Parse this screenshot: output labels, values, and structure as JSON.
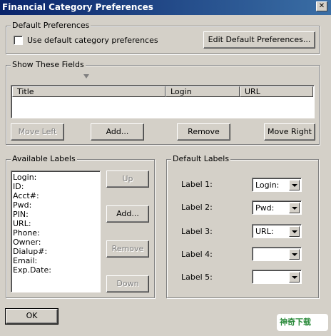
{
  "window": {
    "title": "Financial Category Preferences",
    "close_glyph": "✕"
  },
  "default_preferences": {
    "label": "Default Preferences",
    "checkbox_label": "Use default category preferences",
    "checkbox_checked": false,
    "edit_button": "Edit Default Preferences..."
  },
  "show_fields": {
    "label": "Show These Fields",
    "columns": [
      "Title",
      "Login",
      "URL"
    ],
    "buttons": {
      "move_left": "Move Left",
      "add": "Add...",
      "remove": "Remove",
      "move_right": "Move Right"
    }
  },
  "available_labels": {
    "label": "Available Labels",
    "items": [
      "Login:",
      "ID:",
      "Acct#:",
      "Pwd:",
      "PIN:",
      "URL:",
      "Phone:",
      "Owner:",
      "Dialup#:",
      "Email:",
      "Exp.Date:"
    ],
    "buttons": {
      "up": "Up",
      "add": "Add...",
      "remove": "Remove",
      "down": "Down"
    }
  },
  "default_labels": {
    "label": "Default Labels",
    "rows": [
      {
        "label": "Label 1:",
        "value": "Login:"
      },
      {
        "label": "Label 2:",
        "value": "Pwd:"
      },
      {
        "label": "Label 3:",
        "value": "URL:"
      },
      {
        "label": "Label 4:",
        "value": ""
      },
      {
        "label": "Label 5:",
        "value": ""
      }
    ]
  },
  "footer": {
    "ok_button": "OK"
  },
  "watermark": {
    "text": "神奇下载"
  },
  "colors": {
    "titlebar": "#0a246a",
    "face": "#d4d0c8",
    "disabled_text": "#808080"
  }
}
